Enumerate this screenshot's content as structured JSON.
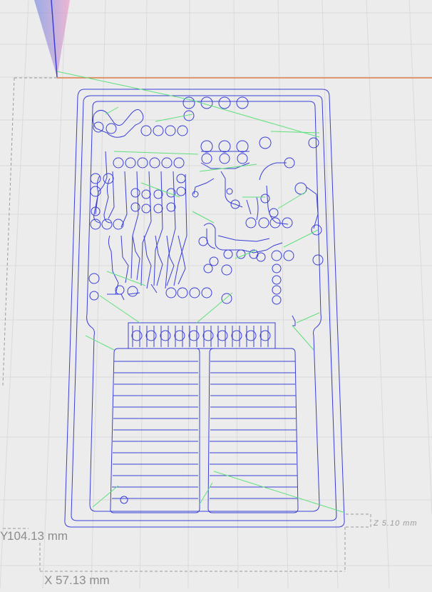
{
  "dimensions": {
    "y_prefix": "Y",
    "y_length": "104.13 mm",
    "x_length": "X 57.13 mm",
    "z_height": "Z 5.10 mm"
  },
  "colors": {
    "background": "#ececec",
    "grid": "#dcdcdc",
    "toolpath_cut": "#3a3fd6",
    "toolpath_travel": "#5ee07a",
    "x_axis": "#e06a2a",
    "bounding_box": "#9a9a9a"
  },
  "icons": {
    "tool_cone": "cone-icon"
  }
}
